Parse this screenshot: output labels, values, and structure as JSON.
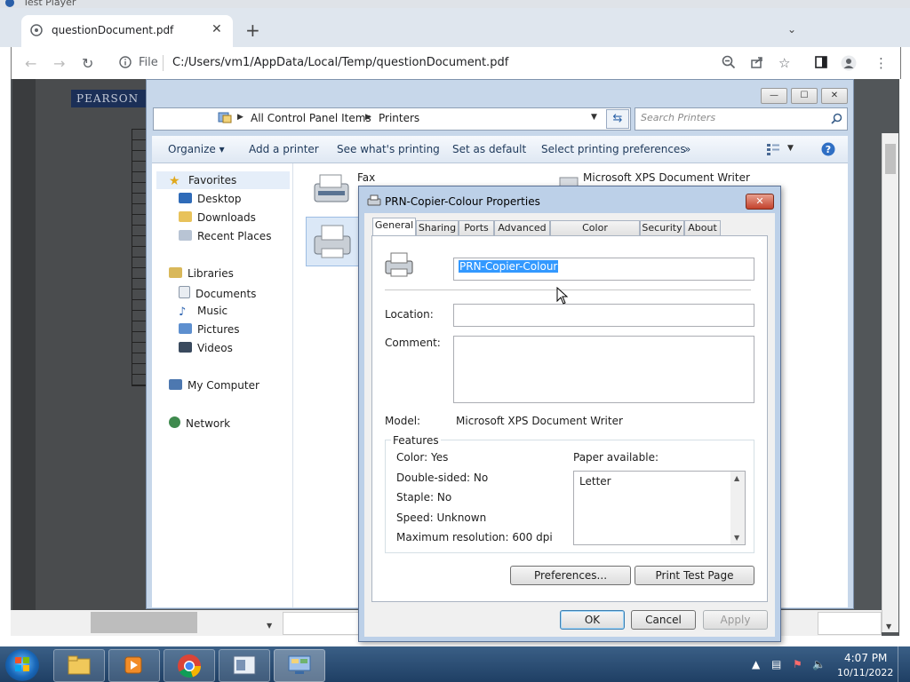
{
  "test_player": {
    "title": "Test Player"
  },
  "browser": {
    "tab_title": "questionDocument.pdf",
    "tab_close": "✕",
    "new_tab": "+",
    "url_scheme_label": "File",
    "url": "C:/Users/vm1/AppData/Local/Temp/questionDocument.pdf"
  },
  "pdf": {
    "brand": "PEARSON"
  },
  "explorer": {
    "breadcrumb": [
      "All Control Panel Items",
      "Printers"
    ],
    "search_placeholder": "Search Printers",
    "toolbar": [
      "Organize ▾",
      "Add a printer",
      "See what's printing",
      "Set as default",
      "Select printing preferences",
      "»"
    ],
    "nav": {
      "favorites": "Favorites",
      "desktop": "Desktop",
      "downloads": "Downloads",
      "recent": "Recent Places",
      "libraries": "Libraries",
      "documents": "Documents",
      "music": "Music",
      "pictures": "Pictures",
      "videos": "Videos",
      "computer": "My Computer",
      "network": "Network"
    },
    "items": {
      "fax": "Fax",
      "xps": "Microsoft XPS Document Writer"
    }
  },
  "dialog": {
    "title": "PRN-Copier-Colour Properties",
    "tabs": [
      "General",
      "Sharing",
      "Ports",
      "Advanced",
      "Color Management",
      "Security",
      "About"
    ],
    "printer_name": "PRN-Copier-Colour",
    "location_label": "Location:",
    "comment_label": "Comment:",
    "model_label": "Model:",
    "model_value": "Microsoft XPS Document Writer",
    "features_title": "Features",
    "features": {
      "color": "Color: Yes",
      "duplex": "Double-sided: No",
      "staple": "Staple: No",
      "speed": "Speed: Unknown",
      "resolution": "Maximum resolution: 600 dpi"
    },
    "paper_label": "Paper available:",
    "paper_items": [
      "Letter"
    ],
    "buttons": {
      "preferences": "Preferences...",
      "test_page": "Print Test Page",
      "ok": "OK",
      "cancel": "Cancel",
      "apply": "Apply"
    }
  },
  "taskbar": {
    "time": "4:07 PM",
    "date": "10/11/2022"
  }
}
